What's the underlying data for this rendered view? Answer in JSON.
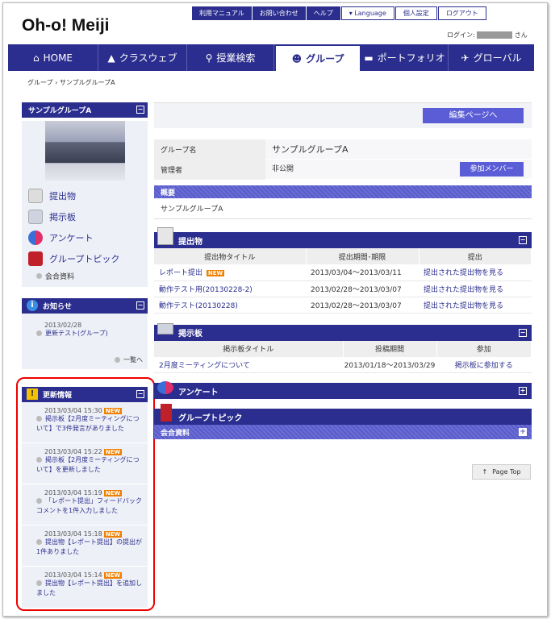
{
  "header": {
    "logo": "Oh-o! Meiji",
    "util_links": [
      "利用マニュアル",
      "お問い合わせ",
      "ヘルプ",
      "▾ Language",
      "個人設定",
      "ログアウト"
    ],
    "login_label": "ログイン:",
    "login_suffix": "さん"
  },
  "nav": [
    {
      "label": "HOME",
      "icon": "home-icon"
    },
    {
      "label": "クラスウェブ",
      "icon": "mortarboard-icon"
    },
    {
      "label": "授業検索",
      "icon": "search-icon"
    },
    {
      "label": "グループ",
      "icon": "people-icon"
    },
    {
      "label": "ポートフォリオ",
      "icon": "folder-icon"
    },
    {
      "label": "グローバル",
      "icon": "airplane-icon"
    }
  ],
  "breadcrumb": {
    "root": "グループ",
    "sep": "›",
    "current": "サンプルグループA"
  },
  "sidebar": {
    "group_title": "サンプルグループA",
    "items": [
      "提出物",
      "掲示板",
      "アンケート",
      "グループトピック"
    ],
    "sub_item": "会合資料",
    "notice": {
      "title": "お知らせ",
      "date": "2013/02/28",
      "text": "更新テスト(グループ)",
      "more": "一覧へ"
    },
    "updates": {
      "title": "更新情報",
      "new_label": "NEW",
      "entries": [
        {
          "date": "2013/03/04 15:30",
          "text": "掲示板【2月度ミーティングについて】で3件発言がありました"
        },
        {
          "date": "2013/03/04 15:22",
          "text": "掲示板【2月度ミーティングについて】を更新しました"
        },
        {
          "date": "2013/03/04 15:19",
          "text": "「レポート提出」フィードバックコメントを1件入力しました"
        },
        {
          "date": "2013/03/04 15:18",
          "text": "提出物【レポート提出】の提出が1件ありました"
        },
        {
          "date": "2013/03/04 15:14",
          "text": "提出物【レポート提出】を追加しました"
        }
      ]
    }
  },
  "main": {
    "edit_button": "編集ページへ",
    "group_name_label": "グループ名",
    "group_name": "サンプルグループA",
    "admin_label": "管理者",
    "admin_value": "非公開",
    "members_button": "参加メンバー",
    "overview_title": "概要",
    "overview_text": "サンプルグループA",
    "submissions": {
      "title": "提出物",
      "headers": [
        "提出物タイトル",
        "提出期間･期限",
        "提出"
      ],
      "rows": [
        {
          "title": "レポート提出",
          "new": "NEW",
          "period": "2013/03/04〜2013/03/11",
          "link": "提出された提出物を見る"
        },
        {
          "title": "動作テスト用(20130228-2)",
          "new": "",
          "period": "2013/02/28〜2013/03/07",
          "link": "提出された提出物を見る"
        },
        {
          "title": "動作テスト(20130228)",
          "new": "",
          "period": "2013/02/28〜2013/03/07",
          "link": "提出された提出物を見る"
        }
      ]
    },
    "board": {
      "title": "掲示板",
      "headers": [
        "掲示板タイトル",
        "投稿期間",
        "参加"
      ],
      "rows": [
        {
          "title": "2月度ミーティングについて",
          "period": "2013/01/18〜2013/03/29",
          "link": "掲示板に参加する"
        }
      ]
    },
    "survey_title": "アンケート",
    "topic_title": "グループトピック",
    "meeting_title": "会合資料",
    "page_top": "Page Top"
  }
}
